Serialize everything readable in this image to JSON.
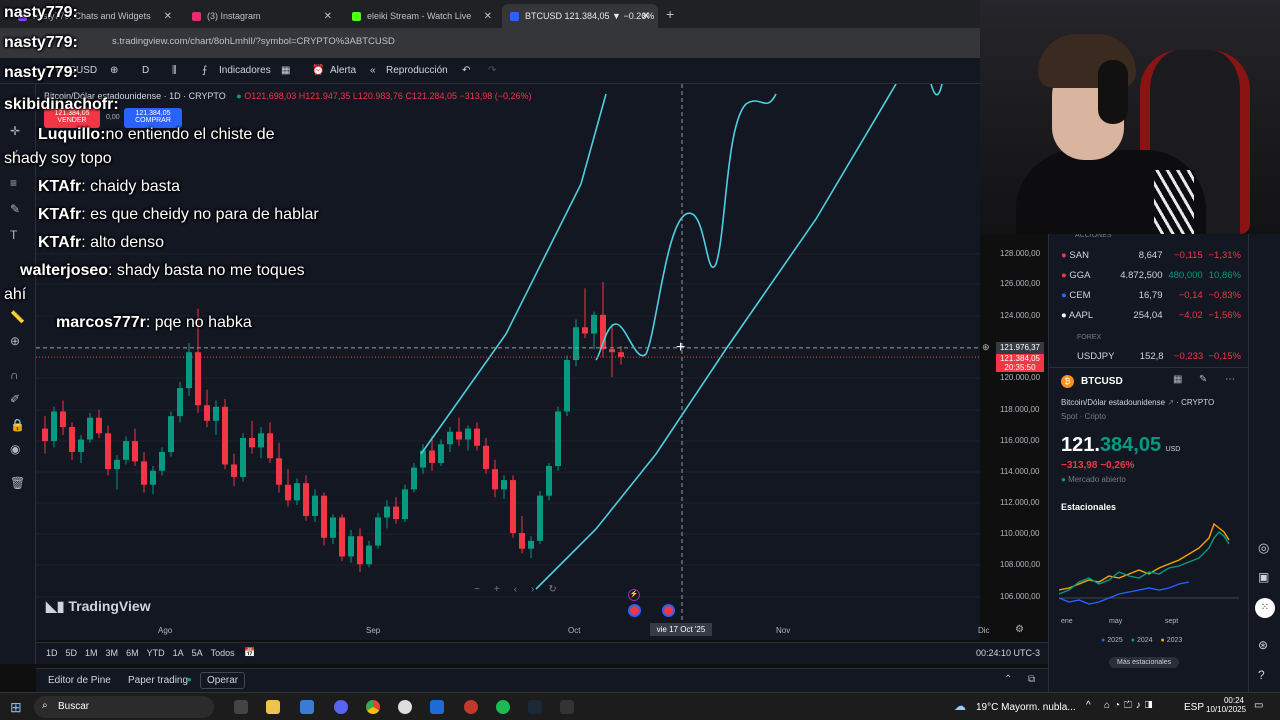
{
  "browser": {
    "tabs": [
      {
        "label": "nasty779: Chats and Widgets",
        "color": "#9146ff"
      },
      {
        "label": "(3) Instagram",
        "color": "#e1306c"
      },
      {
        "label": "eleiki Stream - Watch Live",
        "color": "#53fc18"
      },
      {
        "label": "BTCUSD 121.384,05 ▼ −0.26%",
        "color": "#2962ff"
      }
    ],
    "url": "s.tradingview.com/chart/8ohLmhlI/?symbol=CRYPTO%3ABTCUSD"
  },
  "toolbar": {
    "symbol": "BTCUSD",
    "interval": "D",
    "indicators": "Indicadores",
    "alert": "Alerta",
    "replay": "Reproducción"
  },
  "legend": {
    "name": "Bitcoin/Dólar estadounidense · 1D · CRYPTO",
    "o": "O121.698,03",
    "h": "H121.947,35",
    "l": "L120.983,76",
    "c": "C121.284,05",
    "chg": "−313,98 (−0,26%)",
    "sell_price": "121.384,05",
    "sell_label": "VENDER",
    "spread": "0,00",
    "buy_price": "121.384,05",
    "buy_label": "COMPRAR"
  },
  "chart_data": {
    "type": "candlestick",
    "y_ticks": [
      "128.000,00",
      "126.000,00",
      "124.000,00",
      "120.000,00",
      "118.000,00",
      "116.000,00",
      "114.000,00",
      "112.000,00",
      "110.000,00",
      "108.000,00",
      "106.000,00"
    ],
    "x_ticks": [
      "Ago",
      "Sep",
      "Oct",
      "Nov",
      "Dic"
    ],
    "crosshair_price": "121.976,37",
    "last_price": "121.384,05",
    "countdown": "20:35:50",
    "crosshair_date": "vie 17 Oct '25",
    "candles": [
      [
        116800,
        117600,
        115200,
        116000
      ],
      [
        116000,
        118200,
        115600,
        117900
      ],
      [
        117900,
        118600,
        116400,
        116900
      ],
      [
        116900,
        117200,
        114800,
        115300
      ],
      [
        115300,
        116400,
        114600,
        116100
      ],
      [
        116100,
        117800,
        115900,
        117500
      ],
      [
        117500,
        118000,
        116200,
        116500
      ],
      [
        116500,
        117000,
        113800,
        114200
      ],
      [
        114200,
        115100,
        112900,
        114800
      ],
      [
        114800,
        116300,
        114500,
        116000
      ],
      [
        116000,
        116800,
        114400,
        114700
      ],
      [
        114700,
        115300,
        112700,
        113200
      ],
      [
        113200,
        114400,
        112600,
        114100
      ],
      [
        114100,
        115600,
        113800,
        115300
      ],
      [
        115300,
        117900,
        115000,
        117600
      ],
      [
        117600,
        119800,
        117200,
        119400
      ],
      [
        119400,
        122300,
        118900,
        121700
      ],
      [
        121700,
        124500,
        117800,
        118300
      ],
      [
        118300,
        119300,
        116900,
        117300
      ],
      [
        117300,
        118600,
        116400,
        118200
      ],
      [
        118200,
        118700,
        114200,
        114500
      ],
      [
        114500,
        115200,
        113100,
        113700
      ],
      [
        113700,
        116500,
        113400,
        116200
      ],
      [
        116200,
        117300,
        115200,
        115600
      ],
      [
        115600,
        116900,
        114900,
        116500
      ],
      [
        116500,
        117200,
        114600,
        114900
      ],
      [
        114900,
        115900,
        112700,
        113200
      ],
      [
        113200,
        114200,
        111800,
        112200
      ],
      [
        112200,
        113600,
        111900,
        113300
      ],
      [
        113300,
        113800,
        110900,
        111200
      ],
      [
        111200,
        112900,
        110800,
        112500
      ],
      [
        112500,
        112700,
        109300,
        109800
      ],
      [
        109800,
        111300,
        109400,
        111100
      ],
      [
        111100,
        111300,
        108300,
        108600
      ],
      [
        108600,
        110300,
        108200,
        109900
      ],
      [
        109900,
        110400,
        107600,
        108100
      ],
      [
        108100,
        109600,
        107900,
        109300
      ],
      [
        109300,
        111400,
        109100,
        111100
      ],
      [
        111100,
        112200,
        110400,
        111800
      ],
      [
        111800,
        112400,
        110700,
        111000
      ],
      [
        111000,
        113200,
        110800,
        112900
      ],
      [
        112900,
        114600,
        112700,
        114300
      ],
      [
        114300,
        115800,
        113900,
        115400
      ],
      [
        115400,
        116300,
        114100,
        114600
      ],
      [
        114600,
        116100,
        114400,
        115800
      ],
      [
        115800,
        116900,
        115300,
        116600
      ],
      [
        116600,
        117500,
        115700,
        116100
      ],
      [
        116100,
        117000,
        115400,
        116800
      ],
      [
        116800,
        117200,
        115400,
        115700
      ],
      [
        115700,
        116200,
        113900,
        114200
      ],
      [
        114200,
        114800,
        112400,
        112900
      ],
      [
        112900,
        113800,
        112300,
        113500
      ],
      [
        113500,
        113800,
        109800,
        110100
      ],
      [
        110100,
        111200,
        108800,
        109100
      ],
      [
        109100,
        109900,
        108500,
        109600
      ],
      [
        109600,
        112800,
        109400,
        112500
      ],
      [
        112500,
        114600,
        112200,
        114400
      ],
      [
        114400,
        118200,
        114100,
        117900
      ],
      [
        117900,
        121500,
        117600,
        121200
      ],
      [
        121200,
        123800,
        120800,
        123300
      ],
      [
        123300,
        125800,
        122600,
        122900
      ],
      [
        122900,
        124300,
        121900,
        124100
      ],
      [
        124100,
        126200,
        121400,
        121900
      ],
      [
        121900,
        123500,
        120100,
        121700
      ],
      [
        121700,
        122100,
        120900,
        121400
      ]
    ]
  },
  "chat": [
    {
      "user": "nasty779:",
      "msg": ""
    },
    {
      "user": "nasty779:",
      "msg": ""
    },
    {
      "user": "nasty779:",
      "msg": ""
    },
    {
      "user": "skibidinachofr:",
      "msg": ""
    },
    {
      "user": "Luquillo:",
      "msg": "no entiendo el chiste de"
    },
    {
      "user": "",
      "msg": "shady soy topo"
    },
    {
      "user": "KTAfr",
      "msg": ": chaidy basta"
    },
    {
      "user": "KTAfr",
      "msg": ": es que cheidy no para de hablar"
    },
    {
      "user": "KTAfr",
      "msg": ": alto denso"
    },
    {
      "user": "walterjoseo",
      "msg": ": shady basta no me toques"
    },
    {
      "user": "",
      "msg": "ahí"
    },
    {
      "user": "marcos777r",
      "msg": ": pqe no habka"
    }
  ],
  "watermark": "TradingView",
  "ranges": [
    "1D",
    "5D",
    "1M",
    "3M",
    "6M",
    "YTD",
    "1A",
    "5A",
    "Todos"
  ],
  "clock": "00:24:10 UTC-3",
  "bottom_tabs": [
    "Editor de Pine",
    "Paper trading",
    "Operar"
  ],
  "watchlist": {
    "section1": "ACCIONES",
    "rows": [
      {
        "sym": "SAN",
        "last": "8,647",
        "ch": "−0,115",
        "pct": "−1,31%",
        "color": "#f23645"
      },
      {
        "sym": "GGA",
        "last": "4.872,500",
        "ch": "480,000",
        "pct": "10,86%",
        "color": "#f23645"
      },
      {
        "sym": "CEM",
        "last": "16,79",
        "ch": "−0,14",
        "pct": "−0,83%",
        "color": "#2962ff"
      },
      {
        "sym": "AAPL",
        "last": "254,04",
        "ch": "−4,02",
        "pct": "−1,56%",
        "color": "#ffffff"
      }
    ],
    "section2": "FOREX",
    "forex_row": {
      "sym": "USDJPY",
      "last": "152,8",
      "ch": "−0,233",
      "pct": "−0,15%"
    }
  },
  "details": {
    "symbol": "BTCUSD",
    "name": "Bitcoin/Dólar estadounidense",
    "exchange": "CRYPTO",
    "type": "Spot · Cripto",
    "price_main": "121.",
    "price_dec": "384,05",
    "currency": "USD",
    "change": "−313,98",
    "change_pct": "−0,26%",
    "market": "Mercado abierto",
    "seasonals_title": "Estacionales",
    "months": [
      "ene",
      "may",
      "sept"
    ],
    "years": [
      {
        "y": "2025",
        "c": "#2962ff"
      },
      {
        "y": "2024",
        "c": "#089981"
      },
      {
        "y": "2023",
        "c": "#f7a600"
      }
    ],
    "more": "Más estacionales"
  },
  "taskbar": {
    "search": "Buscar",
    "weather": "19°C  Mayorm. nubla...",
    "lang": "ESP",
    "time": "00:24",
    "date": "10/10/2025"
  }
}
